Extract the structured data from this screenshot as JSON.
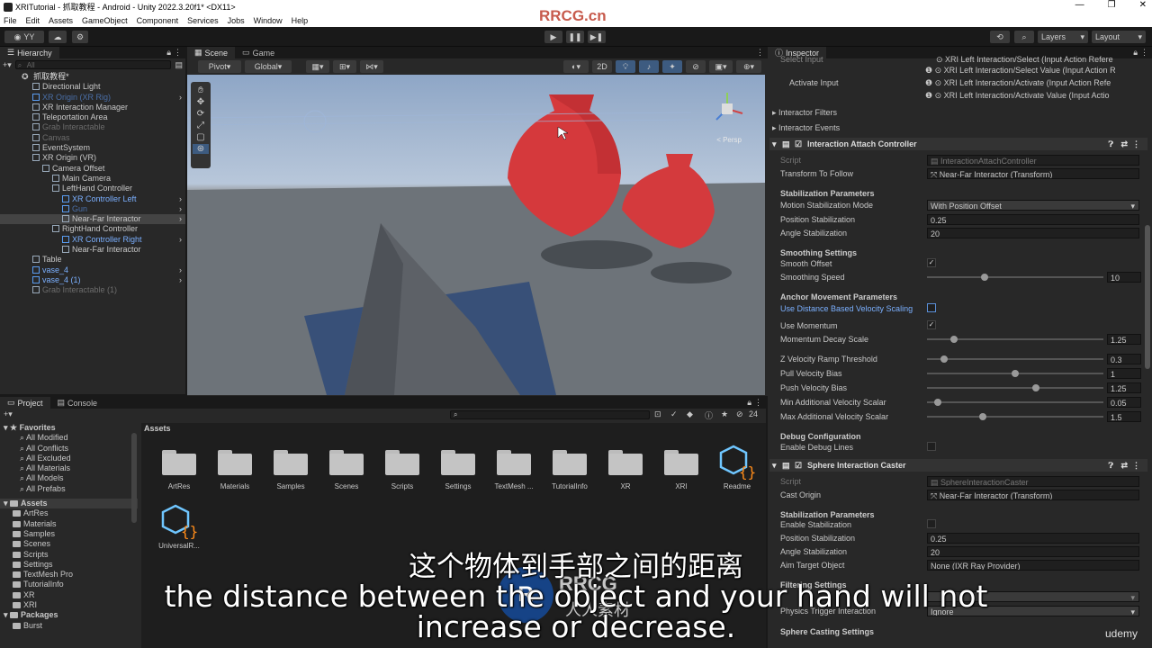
{
  "window": {
    "title": "XRITutorial - 抓取教程 - Android - Unity 2022.3.20f1* <DX11>"
  },
  "menu": [
    "File",
    "Edit",
    "Assets",
    "GameObject",
    "Component",
    "Services",
    "Jobs",
    "Window",
    "Help"
  ],
  "toolbar": {
    "account": "YY",
    "layers": "Layers",
    "layout": "Layout"
  },
  "hierarchy": {
    "tab": "Hierarchy",
    "search_placeholder": "All",
    "scene": "抓取教程*",
    "items": [
      {
        "label": "Directional Light",
        "indent": 2,
        "style": "normal"
      },
      {
        "label": "XR Origin (XR Rig)",
        "indent": 2,
        "style": "grey-blue"
      },
      {
        "label": "XR Interaction Manager",
        "indent": 2,
        "style": "normal"
      },
      {
        "label": "Teleportation Area",
        "indent": 2,
        "style": "normal"
      },
      {
        "label": "Grab Interactable",
        "indent": 2,
        "style": "grey"
      },
      {
        "label": "Canvas",
        "indent": 2,
        "style": "grey"
      },
      {
        "label": "EventSystem",
        "indent": 2,
        "style": "normal"
      },
      {
        "label": "XR Origin (VR)",
        "indent": 2,
        "style": "normal"
      },
      {
        "label": "Camera Offset",
        "indent": 3,
        "style": "normal"
      },
      {
        "label": "Main Camera",
        "indent": 4,
        "style": "normal"
      },
      {
        "label": "LeftHand Controller",
        "indent": 4,
        "style": "normal"
      },
      {
        "label": "XR Controller Left",
        "indent": 5,
        "style": "blue"
      },
      {
        "label": "Gun",
        "indent": 5,
        "style": "grey-blue"
      },
      {
        "label": "Near-Far Interactor",
        "indent": 5,
        "style": "selected"
      },
      {
        "label": "RightHand Controller",
        "indent": 4,
        "style": "normal"
      },
      {
        "label": "XR Controller Right",
        "indent": 5,
        "style": "blue"
      },
      {
        "label": "Near-Far Interactor",
        "indent": 5,
        "style": "normal"
      },
      {
        "label": "Table",
        "indent": 2,
        "style": "normal"
      },
      {
        "label": "vase_4",
        "indent": 2,
        "style": "blue"
      },
      {
        "label": "vase_4 (1)",
        "indent": 2,
        "style": "blue"
      },
      {
        "label": "Grab Interactable (1)",
        "indent": 2,
        "style": "grey"
      }
    ]
  },
  "scene": {
    "tabs": [
      "Scene",
      "Game"
    ],
    "pivot": "Pivot",
    "global": "Global",
    "mode_2d": "2D",
    "persp": "< Persp"
  },
  "project": {
    "tabs": [
      "Project",
      "Console"
    ],
    "favorites_title": "Favorites",
    "favorites": [
      "All Modified",
      "All Conflicts",
      "All Excluded",
      "All Materials",
      "All Models",
      "All Prefabs"
    ],
    "assets_title": "Assets",
    "asset_folders": [
      "ArtRes",
      "Materials",
      "Samples",
      "Scenes",
      "Scripts",
      "Settings",
      "TextMesh Pro",
      "TutorialInfo",
      "XR",
      "XRI"
    ],
    "packages_title": "Packages",
    "packages": [
      "Burst"
    ],
    "breadcrumb": "Assets",
    "grid_items": [
      "ArtRes",
      "Materials",
      "Samples",
      "Scenes",
      "Scripts",
      "Settings",
      "TextMesh ...",
      "TutorialInfo",
      "XR",
      "XRI",
      "Readme"
    ],
    "grid_items_row2": [
      "UniversalR..."
    ],
    "count": "24"
  },
  "inspector": {
    "tab": "Inspector",
    "select_input_label": "Select Input",
    "select_input_v1": "XRI Left Interaction/Select (Input Action Refere",
    "select_input_v2": "XRI Left Interaction/Select Value (Input Action R",
    "activate_input_label": "Activate Input",
    "activate_v1": "XRI Left Interaction/Activate (Input Action Refe",
    "activate_v2": "XRI Left Interaction/Activate Value (Input Actio",
    "interactor_filters": "Interactor Filters",
    "interactor_events": "Interactor Events",
    "attach_title": "Interaction Attach Controller",
    "script_label": "Script",
    "attach_script": "InteractionAttachController",
    "transform_follow_label": "Transform To Follow",
    "transform_follow_val": "Near-Far Interactor (Transform)",
    "stab_params": "Stabilization Parameters",
    "motion_mode_label": "Motion Stabilization Mode",
    "motion_mode_val": "With Position Offset",
    "pos_stab_label": "Position Stabilization",
    "pos_stab_val": "0.25",
    "angle_stab_label": "Angle Stabilization",
    "angle_stab_val": "20",
    "smoothing_settings": "Smoothing Settings",
    "smooth_offset_label": "Smooth Offset",
    "smooth_speed_label": "Smoothing Speed",
    "smooth_speed_val": "10",
    "anchor_params": "Anchor Movement Parameters",
    "use_distance_label": "Use Distance Based Velocity Scaling",
    "use_momentum_label": "Use Momentum",
    "momentum_decay_label": "Momentum Decay Scale",
    "momentum_decay_val": "1.25",
    "z_ramp_label": "Z Velocity Ramp Threshold",
    "z_ramp_val": "0.3",
    "pull_label": "Pull Velocity Bias",
    "pull_val": "1",
    "push_label": "Push Velocity Bias",
    "push_val": "1.25",
    "min_add_label": "Min Additional Velocity Scalar",
    "min_add_val": "0.05",
    "max_add_label": "Max Additional Velocity Scalar",
    "max_add_val": "1.5",
    "debug_config": "Debug Configuration",
    "enable_debug_label": "Enable Debug Lines",
    "caster_title": "Sphere Interaction Caster",
    "caster_script": "SphereInteractionCaster",
    "cast_origin_label": "Cast Origin",
    "cast_origin_val": "Near-Far Interactor (Transform)",
    "stab_params2": "Stabilization Parameters",
    "enable_stab_label": "Enable Stabilization",
    "pos_stab2_val": "0.25",
    "angle_stab2_val": "20",
    "aim_target_label": "Aim Target Object",
    "aim_target_val": "None (IXR Ray Provider)",
    "filtering_settings": "Filtering Settings",
    "physics_trigger_label": "Physics Trigger Interaction",
    "physics_trigger_val": "Ignore",
    "sphere_casting": "Sphere Casting Settings"
  },
  "sliders": {
    "smooth_speed": 0.32,
    "momentum_decay": 0.14,
    "z_ramp": 0.08,
    "pull": 0.5,
    "push": 0.62,
    "min_add": 0.04,
    "max_add": 0.31
  },
  "watermark": {
    "top": "RRCG.cn",
    "logo": "RRCG",
    "logo_sub": "人人素材",
    "corner": "udemy"
  },
  "subtitles": {
    "zh": "这个物体到手部之间的距离",
    "en_line1": "the distance between the object and your hand will not",
    "en_line2": "increase or decrease."
  }
}
